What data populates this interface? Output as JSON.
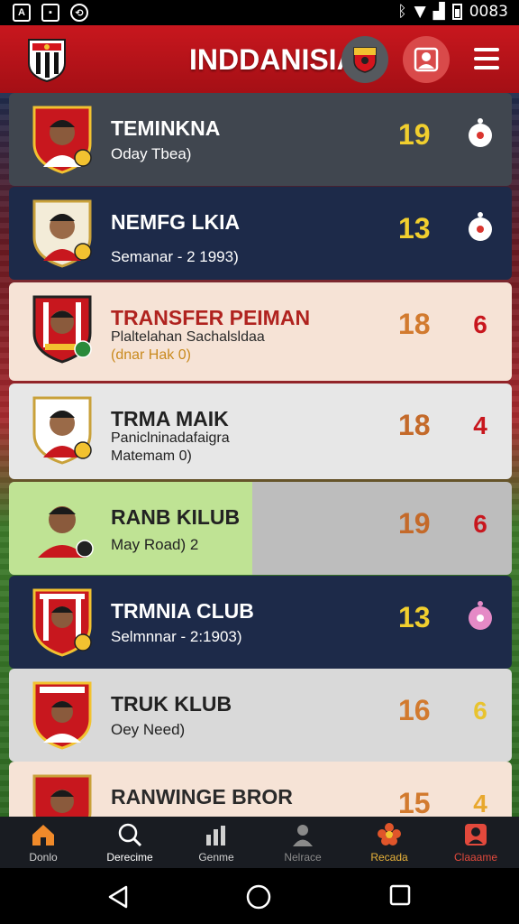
{
  "status_bar": {
    "time": "0083"
  },
  "header": {
    "title": "INDDANISIA"
  },
  "list": [
    {
      "title": "TEMINKNA",
      "subtitle": "Oday Tbea)",
      "number": "19",
      "indicator": ""
    },
    {
      "title": "NEMFG LKIA",
      "subtitle": "Semanar - 2 1993)",
      "number": "13",
      "indicator": ""
    },
    {
      "title": "TRANSFER PEIMAN",
      "subtitle": "Plaltelahan Sachalsldaa",
      "subtitle2": "(dnar Hak 0)",
      "number": "18",
      "indicator": "6"
    },
    {
      "title": "TRMA MAIK",
      "subtitle": "Paniclninadafaigra",
      "subtitle2": "Matemam 0)",
      "number": "18",
      "indicator": "4"
    },
    {
      "title": "RANB KILUB",
      "subtitle": "May Road)   2",
      "number": "19",
      "indicator": "6"
    },
    {
      "title": "TRMNIA CLUB",
      "subtitle": "Selmnnar - 2:1903)",
      "number": "13",
      "indicator": ""
    },
    {
      "title": "TRUK KLUB",
      "subtitle": "Oey Need)",
      "number": "16",
      "indicator": "6"
    },
    {
      "title": "RANWINGE BROR",
      "subtitle": "",
      "number": "15",
      "indicator": "4"
    }
  ],
  "bottom_nav": [
    {
      "label": "Donlo",
      "icon": "home-icon",
      "color": "#f08a2a"
    },
    {
      "label": "Derecime",
      "icon": "search-icon",
      "color": "#ffffff"
    },
    {
      "label": "Genme",
      "icon": "stats-icon",
      "color": "#d0d0d0"
    },
    {
      "label": "Nelrace",
      "icon": "person-icon",
      "color": "#8a8a8a"
    },
    {
      "label": "Recada",
      "icon": "flower-icon",
      "color": "#e8b23a"
    },
    {
      "label": "Claaame",
      "icon": "profile-card-icon",
      "color": "#e2493c"
    }
  ],
  "colors": {
    "header": "#c8171e",
    "accent_yellow": "#f1cf2e",
    "accent_red": "#d9352f"
  }
}
